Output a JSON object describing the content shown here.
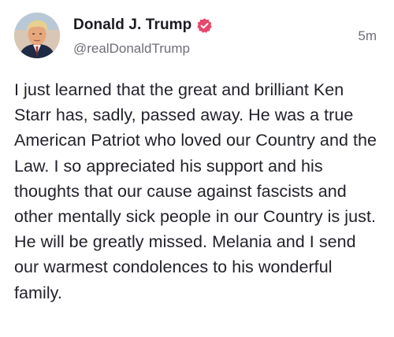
{
  "post": {
    "author": {
      "display_name": "Donald J. Trump",
      "handle": "@realDonaldTrump",
      "verified_icon": "verified-badge-icon",
      "avatar": "profile-photo"
    },
    "timestamp": "5m",
    "body": "I just learned that the great and brilliant Ken Starr has, sadly, passed away. He was a true American Patriot who loved our Country and the Law. I so appreciated his support and his thoughts that our cause against fascists and other mentally sick people in our Country is just. He will be greatly missed. Melania and I send our warmest condolences to his wonderful family."
  },
  "colors": {
    "verified_badge": "#e8466b",
    "name_text": "#1b1b22",
    "secondary_text": "#6e6e78",
    "body_text": "#22222a"
  }
}
